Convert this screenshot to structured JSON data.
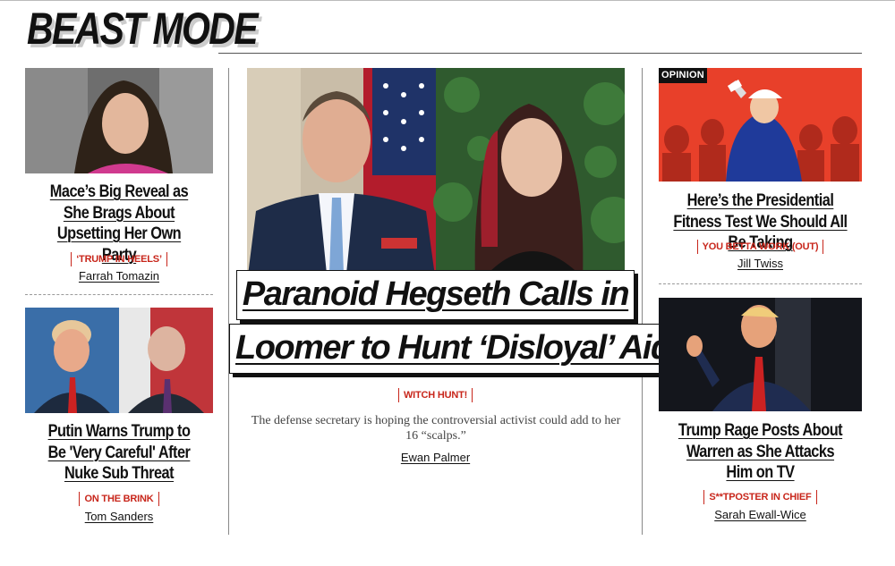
{
  "section": {
    "title": "BEAST MODE"
  },
  "left": {
    "top": {
      "headline": "Mace’s Big Reveal as She Brags About Upsetting Her Own Party",
      "kicker": "‘TRUMP IN HEELS’",
      "author": "Farrah Tomazin"
    },
    "bottom": {
      "headline": "Putin Warns Trump to Be 'Very Careful' After Nuke Sub Threat",
      "kicker": "ON THE BRINK",
      "author": "Tom Sanders"
    }
  },
  "center": {
    "headline_line1": "Paranoid Hegseth Calls in",
    "headline_line2": "Loomer to Hunt ‘Disloyal’ Aides",
    "kicker": "WITCH HUNT!",
    "dek": "The defense secretary is hoping the controversial activist could add to her 16 “scalps.”",
    "author": "Ewan Palmer"
  },
  "right": {
    "top": {
      "badge": "OPINION",
      "headline": "Here’s the Presidential Fitness Test We Should All Be Taking",
      "kicker": "YOU BETTA WORK (OUT)",
      "author": "Jill Twiss"
    },
    "bottom": {
      "headline": "Trump Rage Posts About Warren as She Attacks Him on TV",
      "kicker": "S**TPOSTER IN CHIEF",
      "author": "Sarah Ewall-Wice"
    }
  },
  "colors": {
    "accent": "#c8261b",
    "opinion_bg": "#e8402a"
  }
}
